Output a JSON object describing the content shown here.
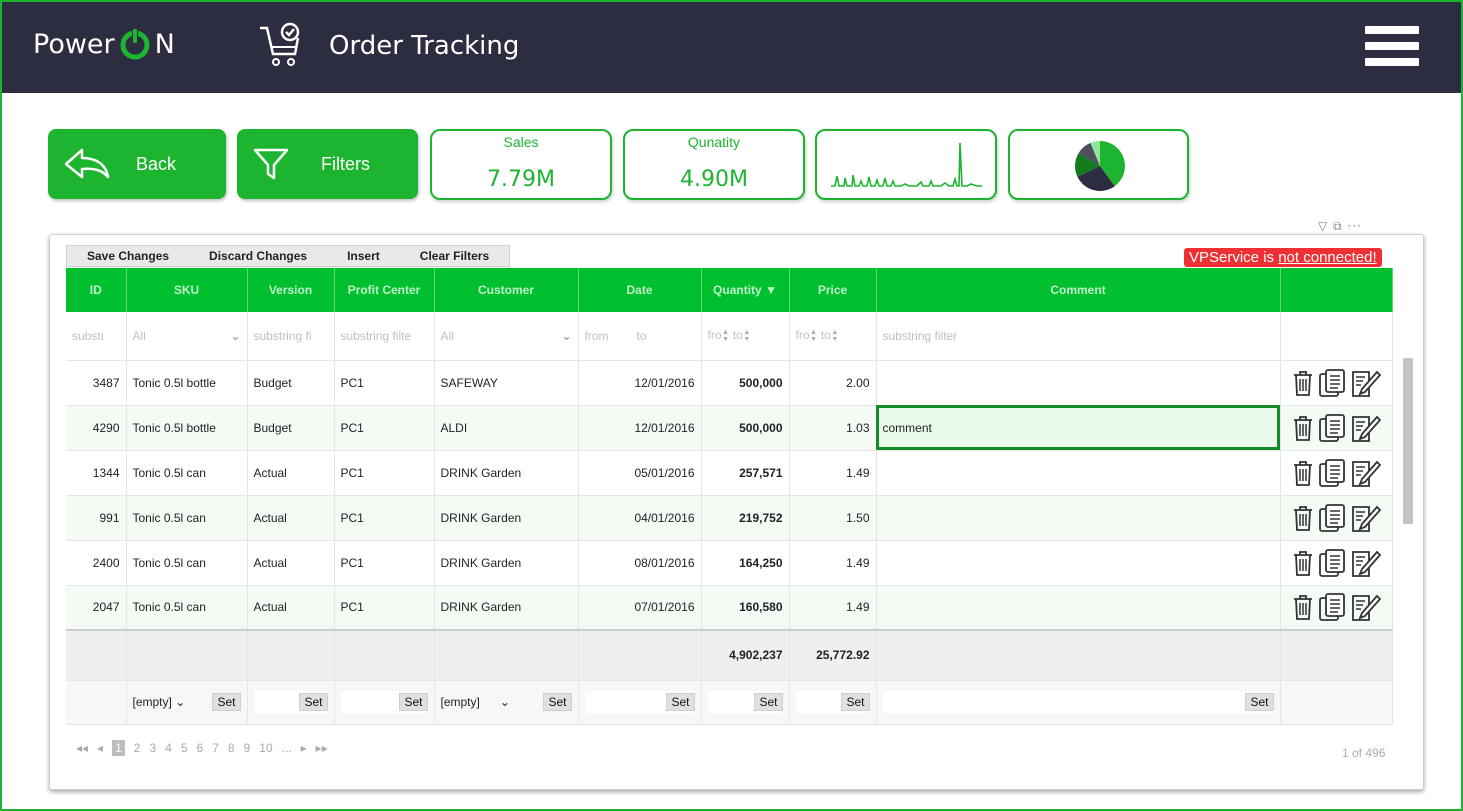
{
  "header": {
    "brand_left": "Power",
    "brand_right": "N",
    "title": "Order Tracking",
    "brand_color": "#1db52f",
    "bar_color": "#2c2d40"
  },
  "actions": {
    "back_label": "Back",
    "filters_label": "Filters"
  },
  "kpis": {
    "sales_title": "Sales",
    "sales_value": "7.79M",
    "quantity_title": "Qunatity",
    "quantity_value": "4.90M"
  },
  "toolbar": {
    "save": "Save Changes",
    "discard": "Discard Changes",
    "insert": "Insert",
    "clear": "Clear Filters"
  },
  "status": {
    "prefix": "VPService is",
    "suffix": "not connected!"
  },
  "table": {
    "columns": [
      "ID",
      "SKU",
      "Version",
      "Profit Center",
      "Customer",
      "Date",
      "Quantity",
      "Price",
      "Comment",
      ""
    ],
    "sort_indicator": "▼",
    "filters": {
      "id": "substı",
      "sku": "All",
      "version": "substring fi",
      "profit_center": "substring filte",
      "customer": "All",
      "date_from": "from",
      "date_to": "to",
      "qty_from": "fro",
      "qty_to": "to",
      "price_from": "fro",
      "price_to": "to",
      "comment": "substring filter"
    },
    "rows": [
      {
        "id": "3487",
        "sku": "Tonic 0.5l bottle",
        "version": "Budget",
        "pc": "PC1",
        "customer": "SAFEWAY",
        "date": "12/01/2016",
        "qty": "500,000",
        "price": "2.00",
        "comment": ""
      },
      {
        "id": "4290",
        "sku": "Tonic 0.5l bottle",
        "version": "Budget",
        "pc": "PC1",
        "customer": "ALDI",
        "date": "12/01/2016",
        "qty": "500,000",
        "price": "1.03",
        "comment": "comment"
      },
      {
        "id": "1344",
        "sku": "Tonic 0.5l can",
        "version": "Actual",
        "pc": "PC1",
        "customer": "DRINK Garden",
        "date": "05/01/2016",
        "qty": "257,571",
        "price": "1.49",
        "comment": ""
      },
      {
        "id": "991",
        "sku": "Tonic 0.5l can",
        "version": "Actual",
        "pc": "PC1",
        "customer": "DRINK Garden",
        "date": "04/01/2016",
        "qty": "219,752",
        "price": "1.50",
        "comment": ""
      },
      {
        "id": "2400",
        "sku": "Tonic 0.5l can",
        "version": "Actual",
        "pc": "PC1",
        "customer": "DRINK Garden",
        "date": "08/01/2016",
        "qty": "164,250",
        "price": "1.49",
        "comment": ""
      },
      {
        "id": "2047",
        "sku": "Tonic 0.5l can",
        "version": "Actual",
        "pc": "PC1",
        "customer": "DRINK Garden",
        "date": "07/01/2016",
        "qty": "160,580",
        "price": "1.49",
        "comment": ""
      }
    ],
    "totals": {
      "qty": "4,902,237",
      "price": "25,772.92"
    },
    "set_row": {
      "empty": "[empty]",
      "set": "Set"
    }
  },
  "pager": {
    "pages": [
      "2",
      "3",
      "4",
      "5",
      "6",
      "7",
      "8",
      "9",
      "10"
    ],
    "current": "1",
    "ellipsis": "...",
    "info": "1 of 496"
  },
  "icons": [
    "power-icon",
    "cart-check-icon",
    "hamburger-icon",
    "back-arrow-icon",
    "funnel-icon",
    "trash-icon",
    "copy-icon",
    "edit-icon"
  ]
}
